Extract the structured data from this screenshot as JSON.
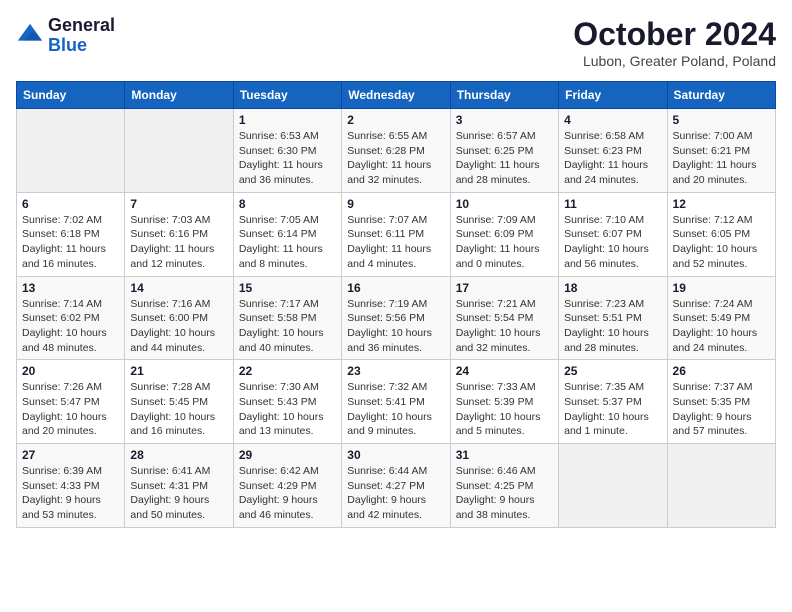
{
  "header": {
    "logo_general": "General",
    "logo_blue": "Blue",
    "month_title": "October 2024",
    "subtitle": "Lubon, Greater Poland, Poland"
  },
  "days_of_week": [
    "Sunday",
    "Monday",
    "Tuesday",
    "Wednesday",
    "Thursday",
    "Friday",
    "Saturday"
  ],
  "weeks": [
    [
      {
        "day": "",
        "info": ""
      },
      {
        "day": "",
        "info": ""
      },
      {
        "day": "1",
        "info": "Sunrise: 6:53 AM\nSunset: 6:30 PM\nDaylight: 11 hours and 36 minutes."
      },
      {
        "day": "2",
        "info": "Sunrise: 6:55 AM\nSunset: 6:28 PM\nDaylight: 11 hours and 32 minutes."
      },
      {
        "day": "3",
        "info": "Sunrise: 6:57 AM\nSunset: 6:25 PM\nDaylight: 11 hours and 28 minutes."
      },
      {
        "day": "4",
        "info": "Sunrise: 6:58 AM\nSunset: 6:23 PM\nDaylight: 11 hours and 24 minutes."
      },
      {
        "day": "5",
        "info": "Sunrise: 7:00 AM\nSunset: 6:21 PM\nDaylight: 11 hours and 20 minutes."
      }
    ],
    [
      {
        "day": "6",
        "info": "Sunrise: 7:02 AM\nSunset: 6:18 PM\nDaylight: 11 hours and 16 minutes."
      },
      {
        "day": "7",
        "info": "Sunrise: 7:03 AM\nSunset: 6:16 PM\nDaylight: 11 hours and 12 minutes."
      },
      {
        "day": "8",
        "info": "Sunrise: 7:05 AM\nSunset: 6:14 PM\nDaylight: 11 hours and 8 minutes."
      },
      {
        "day": "9",
        "info": "Sunrise: 7:07 AM\nSunset: 6:11 PM\nDaylight: 11 hours and 4 minutes."
      },
      {
        "day": "10",
        "info": "Sunrise: 7:09 AM\nSunset: 6:09 PM\nDaylight: 11 hours and 0 minutes."
      },
      {
        "day": "11",
        "info": "Sunrise: 7:10 AM\nSunset: 6:07 PM\nDaylight: 10 hours and 56 minutes."
      },
      {
        "day": "12",
        "info": "Sunrise: 7:12 AM\nSunset: 6:05 PM\nDaylight: 10 hours and 52 minutes."
      }
    ],
    [
      {
        "day": "13",
        "info": "Sunrise: 7:14 AM\nSunset: 6:02 PM\nDaylight: 10 hours and 48 minutes."
      },
      {
        "day": "14",
        "info": "Sunrise: 7:16 AM\nSunset: 6:00 PM\nDaylight: 10 hours and 44 minutes."
      },
      {
        "day": "15",
        "info": "Sunrise: 7:17 AM\nSunset: 5:58 PM\nDaylight: 10 hours and 40 minutes."
      },
      {
        "day": "16",
        "info": "Sunrise: 7:19 AM\nSunset: 5:56 PM\nDaylight: 10 hours and 36 minutes."
      },
      {
        "day": "17",
        "info": "Sunrise: 7:21 AM\nSunset: 5:54 PM\nDaylight: 10 hours and 32 minutes."
      },
      {
        "day": "18",
        "info": "Sunrise: 7:23 AM\nSunset: 5:51 PM\nDaylight: 10 hours and 28 minutes."
      },
      {
        "day": "19",
        "info": "Sunrise: 7:24 AM\nSunset: 5:49 PM\nDaylight: 10 hours and 24 minutes."
      }
    ],
    [
      {
        "day": "20",
        "info": "Sunrise: 7:26 AM\nSunset: 5:47 PM\nDaylight: 10 hours and 20 minutes."
      },
      {
        "day": "21",
        "info": "Sunrise: 7:28 AM\nSunset: 5:45 PM\nDaylight: 10 hours and 16 minutes."
      },
      {
        "day": "22",
        "info": "Sunrise: 7:30 AM\nSunset: 5:43 PM\nDaylight: 10 hours and 13 minutes."
      },
      {
        "day": "23",
        "info": "Sunrise: 7:32 AM\nSunset: 5:41 PM\nDaylight: 10 hours and 9 minutes."
      },
      {
        "day": "24",
        "info": "Sunrise: 7:33 AM\nSunset: 5:39 PM\nDaylight: 10 hours and 5 minutes."
      },
      {
        "day": "25",
        "info": "Sunrise: 7:35 AM\nSunset: 5:37 PM\nDaylight: 10 hours and 1 minute."
      },
      {
        "day": "26",
        "info": "Sunrise: 7:37 AM\nSunset: 5:35 PM\nDaylight: 9 hours and 57 minutes."
      }
    ],
    [
      {
        "day": "27",
        "info": "Sunrise: 6:39 AM\nSunset: 4:33 PM\nDaylight: 9 hours and 53 minutes."
      },
      {
        "day": "28",
        "info": "Sunrise: 6:41 AM\nSunset: 4:31 PM\nDaylight: 9 hours and 50 minutes."
      },
      {
        "day": "29",
        "info": "Sunrise: 6:42 AM\nSunset: 4:29 PM\nDaylight: 9 hours and 46 minutes."
      },
      {
        "day": "30",
        "info": "Sunrise: 6:44 AM\nSunset: 4:27 PM\nDaylight: 9 hours and 42 minutes."
      },
      {
        "day": "31",
        "info": "Sunrise: 6:46 AM\nSunset: 4:25 PM\nDaylight: 9 hours and 38 minutes."
      },
      {
        "day": "",
        "info": ""
      },
      {
        "day": "",
        "info": ""
      }
    ]
  ]
}
